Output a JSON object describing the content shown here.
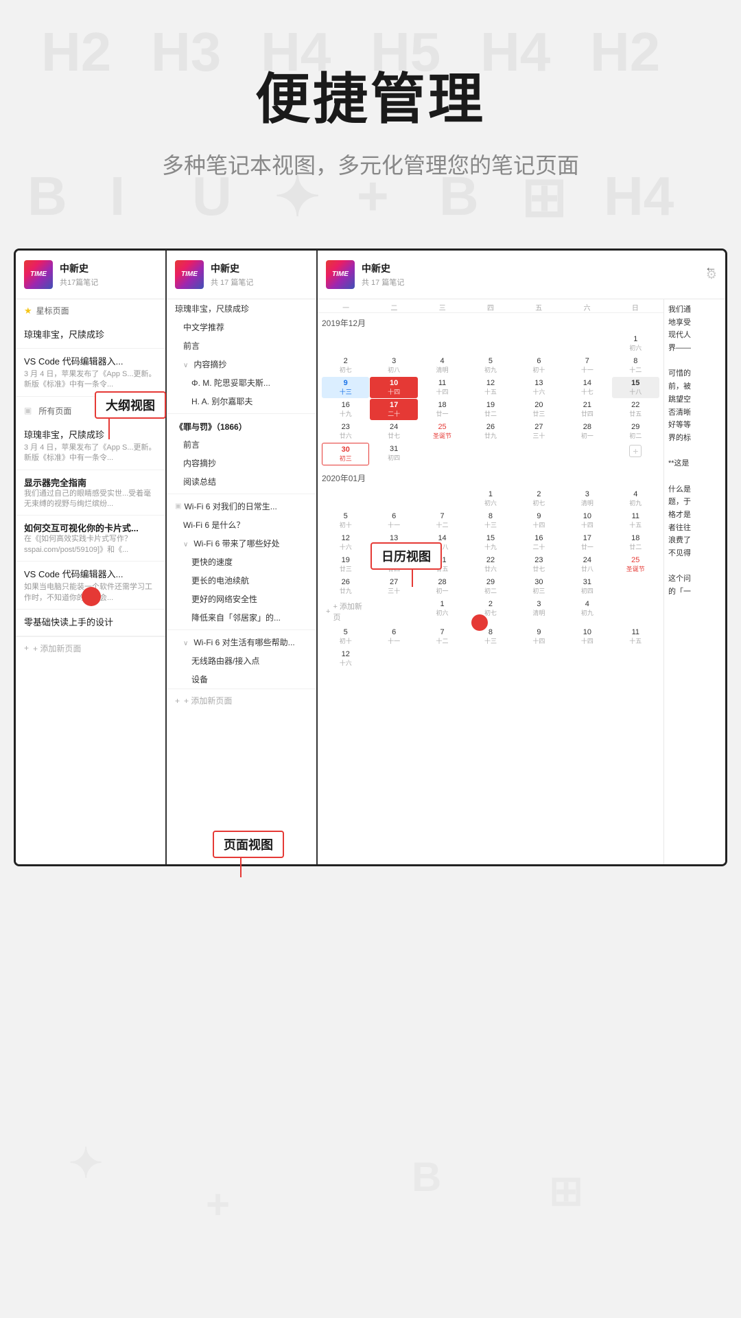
{
  "header": {
    "title": "便捷管理",
    "subtitle": "多种笔记本视图，多元化管理您的笔记页面"
  },
  "notebook": {
    "name": "中新史",
    "count_label": "共 17 篇笔记",
    "count_label2": "共17篇笔记"
  },
  "panel1": {
    "starred_label": "星标页面",
    "items": [
      {
        "title": "琼瑰非宝，尺牍成珍",
        "meta": "",
        "preview": ""
      },
      {
        "title": "VS Code 代码编辑器入...",
        "meta": "3 月 4 日，苹果发布了《App S...",
        "preview": "更新。新版《标准》中有一条令..."
      }
    ],
    "all_pages_label": "所有页面",
    "items2": [
      {
        "title": "琼瑰非宝，尺牍成珍",
        "meta": "3 月 4 日，苹果发布了《App S...",
        "preview": "更新。新版《标准》中有一条令..."
      },
      {
        "title": "显示器完全指南",
        "bold": true,
        "preview": "我们通过自己的眼睛感受实世...受着毫无束缚的视野与绚烂缤纷..."
      },
      {
        "title": "如何交互可视化你的卡片式...",
        "bold": true,
        "preview": "在《[如何高效实践卡片式写作？sspai.com/post/59109]》和《..."
      },
      {
        "title": "VS Code 代码编辑器入...",
        "preview": "如果当电脑只能装一个软件还需学习工作时，不知道你的选择会..."
      },
      {
        "title": "零基础快读上手的设计",
        "preview": ""
      }
    ],
    "add_label": "+ 添加新页面"
  },
  "panel2": {
    "outline_label": "大纲视图",
    "outline_items": [
      {
        "text": "琼瑰非宝，尺牍成珍",
        "indent": 0
      },
      {
        "text": "中文学推荐",
        "indent": 1
      },
      {
        "text": "前言",
        "indent": 1
      },
      {
        "text": "内容摘抄",
        "indent": 1,
        "toggle": "∨"
      },
      {
        "text": "Φ. M. 陀思妥耶夫斯...",
        "indent": 2
      },
      {
        "text": "H. A. 别尔嘉耶夫",
        "indent": 2
      }
    ],
    "book_title": "《罪与罚》（1866）",
    "book_items": [
      {
        "text": "前言",
        "indent": 1
      },
      {
        "text": "内容摘抄",
        "indent": 1
      },
      {
        "text": "阅读总结",
        "indent": 1
      }
    ],
    "separator": true,
    "wifi_title": "Wi-Fi 6 对我们的日常生...",
    "wifi_items": [
      {
        "text": "Wi-Fi 6 是什么？",
        "indent": 1
      },
      {
        "text": "Wi-Fi 6 带来了哪些好处",
        "indent": 1,
        "toggle": "∨"
      },
      {
        "text": "更快的速度",
        "indent": 2
      },
      {
        "text": "更长的电池续航",
        "indent": 2
      },
      {
        "text": "更好的网络安全性",
        "indent": 2
      },
      {
        "text": "降低来自「邻居家」的...",
        "indent": 2
      }
    ],
    "wifi_items2": [
      {
        "text": "Wi-Fi 6 对生活有哪些帮助...",
        "indent": 1,
        "toggle": "∨"
      },
      {
        "text": "无线路由器/接入点",
        "indent": 2
      },
      {
        "text": "设备",
        "indent": 2
      }
    ],
    "add_label": "+ 添加新页面"
  },
  "panel3": {
    "calendar_label_1": "日历视图",
    "months": [
      {
        "label": "2019年12月",
        "weekdays": [
          "一",
          "二",
          "三",
          "四",
          "五",
          "六",
          "日"
        ],
        "days": [
          {
            "d": "",
            "l": "",
            "gray": false
          },
          {
            "d": "",
            "l": "",
            "gray": false
          },
          {
            "d": "",
            "l": "",
            "gray": false
          },
          {
            "d": "",
            "l": "",
            "gray": false
          },
          {
            "d": "",
            "l": "",
            "gray": false
          },
          {
            "d": "",
            "l": "",
            "gray": false
          },
          {
            "d": "1",
            "l": "初六",
            "gray": false
          },
          {
            "d": "2",
            "l": "初七",
            "gray": false
          },
          {
            "d": "3",
            "l": "初八",
            "gray": false
          },
          {
            "d": "4",
            "l": "清明",
            "gray": false
          },
          {
            "d": "5",
            "l": "初九",
            "gray": false
          },
          {
            "d": "6",
            "l": "初十",
            "gray": false
          },
          {
            "d": "7",
            "l": "十一",
            "gray": false
          },
          {
            "d": "8",
            "l": "十二",
            "gray": false
          },
          {
            "d": "9",
            "l": "十三",
            "today": true
          },
          {
            "d": "10",
            "l": "十四",
            "selected": true
          },
          {
            "d": "11",
            "l": "十四",
            "gray": false
          },
          {
            "d": "12",
            "l": "十五",
            "gray": false
          },
          {
            "d": "13",
            "l": "十六",
            "gray": false
          },
          {
            "d": "14",
            "l": "十七",
            "gray": false
          },
          {
            "d": "15",
            "l": "十八",
            "gray": false
          },
          {
            "d": "16",
            "l": "十九",
            "gray": false
          },
          {
            "d": "17",
            "l": "二十",
            "selected2": true
          },
          {
            "d": "18",
            "l": "廿一",
            "gray": false
          },
          {
            "d": "19",
            "l": "廿二",
            "gray": false
          },
          {
            "d": "20",
            "l": "廿三",
            "gray": false
          },
          {
            "d": "21",
            "l": "廿四",
            "gray": false
          },
          {
            "d": "22",
            "l": "廿五",
            "gray": false
          },
          {
            "d": "23",
            "l": "廿六",
            "gray": false
          },
          {
            "d": "24",
            "l": "廿七",
            "gray": false
          },
          {
            "d": "25",
            "l": "圣诞节",
            "holiday": true
          },
          {
            "d": "26",
            "l": "廿九",
            "gray": false
          },
          {
            "d": "27",
            "l": "三十",
            "gray": false
          },
          {
            "d": "28",
            "l": "初一",
            "gray": false
          },
          {
            "d": "29",
            "l": "初二",
            "gray": false
          },
          {
            "d": "30",
            "l": "初三",
            "red": true
          },
          {
            "d": "31",
            "l": "初四",
            "gray": false
          },
          {
            "d": "",
            "l": "",
            "gray": false
          },
          {
            "d": "",
            "l": "",
            "gray": false
          },
          {
            "d": "",
            "l": "",
            "gray": false
          },
          {
            "d": "",
            "l": "",
            "gray": false
          },
          {
            "d": "",
            "l": "",
            "gray": false
          }
        ]
      },
      {
        "label": "2020年01月",
        "days": [
          {
            "d": "",
            "l": ""
          },
          {
            "d": "",
            "l": ""
          },
          {
            "d": "",
            "l": ""
          },
          {
            "d": "1",
            "l": "初六"
          },
          {
            "d": "2",
            "l": "初七"
          },
          {
            "d": "3",
            "l": "清明"
          },
          {
            "d": "4",
            "l": "初九"
          },
          {
            "d": "5",
            "l": "初十"
          },
          {
            "d": "6",
            "l": "十一"
          },
          {
            "d": "7",
            "l": "十二"
          },
          {
            "d": "8",
            "l": "十三"
          },
          {
            "d": "9",
            "l": "十四"
          },
          {
            "d": "10",
            "l": "十四"
          },
          {
            "d": "11",
            "l": "十五"
          },
          {
            "d": "12",
            "l": "十六"
          },
          {
            "d": "13",
            "l": "十七"
          },
          {
            "d": "14",
            "l": "十八"
          },
          {
            "d": "15",
            "l": "十九"
          },
          {
            "d": "16",
            "l": "二十"
          },
          {
            "d": "17",
            "l": "廿一"
          },
          {
            "d": "18",
            "l": "廿二"
          },
          {
            "d": "19",
            "l": "廿三"
          },
          {
            "d": "20",
            "l": "廿四"
          },
          {
            "d": "21",
            "l": "廿五"
          },
          {
            "d": "22",
            "l": "廿六"
          },
          {
            "d": "23",
            "l": "廿七"
          },
          {
            "d": "24",
            "l": "廿八"
          },
          {
            "d": "25",
            "l": "圣诞节"
          },
          {
            "d": "26",
            "l": "廿九"
          },
          {
            "d": "27",
            "l": "三十"
          },
          {
            "d": "28",
            "l": "初一"
          },
          {
            "d": "29",
            "l": "初二"
          },
          {
            "d": "30",
            "l": "初三"
          },
          {
            "d": "31",
            "l": "初四"
          },
          {
            "d": "",
            "l": ""
          }
        ]
      }
    ],
    "right_text_lines": [
      "我们通",
      "地享受",
      "现代人",
      "界——",
      "",
      "可惜的",
      "前，被",
      "跳望空",
      "否清晰",
      "好等等",
      "界的标",
      "",
      "**这是",
      "",
      "什么是",
      "题，于",
      "格才是",
      "者往往",
      "浪费了",
      "不见得",
      "",
      "这个问",
      "的「一"
    ],
    "add_label": "+ 添加新页"
  },
  "annotations": {
    "outline_view": "大纲视图",
    "calendar_view": "日历视图",
    "page_view": "页面视图"
  },
  "watermarks": [
    "H2",
    "H3",
    "H4",
    "H5",
    "H2",
    "B",
    "I",
    "U",
    "✦",
    "+",
    "B",
    "⊞",
    "H4"
  ]
}
